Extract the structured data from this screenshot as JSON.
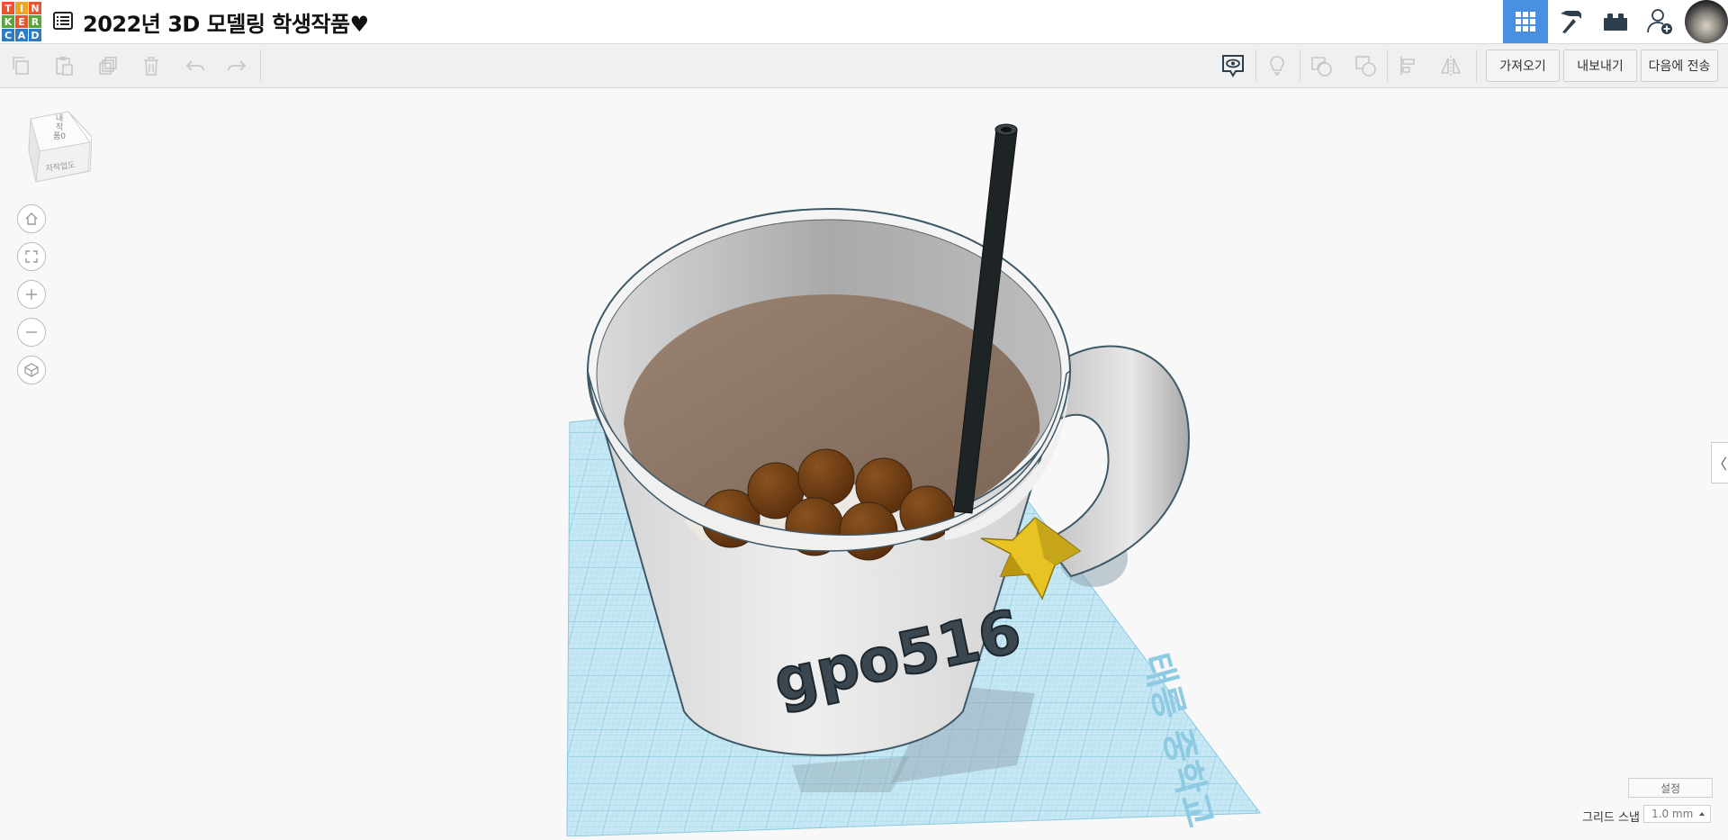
{
  "app": {
    "logo_letters": [
      "T",
      "I",
      "N",
      "K",
      "E",
      "R",
      "C",
      "A",
      "D"
    ],
    "logo_colors": [
      "#e8552e",
      "#f0a523",
      "#e8552e",
      "#57a639",
      "#e8552e",
      "#57a639",
      "#2e7cc4",
      "#2e7cc4",
      "#2e7cc4"
    ],
    "project_title": "2022년 3D 모델링 학생작품♥"
  },
  "header": {
    "buttons": [
      {
        "name": "3d-design-view-icon",
        "active": true
      },
      {
        "name": "minecraft-pickaxe-icon",
        "active": false
      },
      {
        "name": "lego-brick-icon",
        "active": false
      },
      {
        "name": "add-user-icon",
        "active": false
      }
    ]
  },
  "toolbar": {
    "import_label": "가져오기",
    "export_label": "내보내기",
    "send_to_label": "다음에 전송"
  },
  "viewcube": {
    "top_label": "내\n작\n품0",
    "front_label": "자작업도"
  },
  "workplane": {
    "stamp_text": "태릉 중학교"
  },
  "model": {
    "engraved_text": "gpo516"
  },
  "footer": {
    "settings_label": "설정",
    "grid_snap_label": "그리드 스냅",
    "grid_snap_value": "1.0 mm"
  },
  "colors": {
    "accent": "#4a90e2",
    "workplane": "#bfe3f2",
    "mug": "#e3e3e3",
    "drink": "#8a7262",
    "boba": "#6b3a12",
    "straw": "#1e2326",
    "star": "#e8c324",
    "text_dark": "#3a4650"
  }
}
